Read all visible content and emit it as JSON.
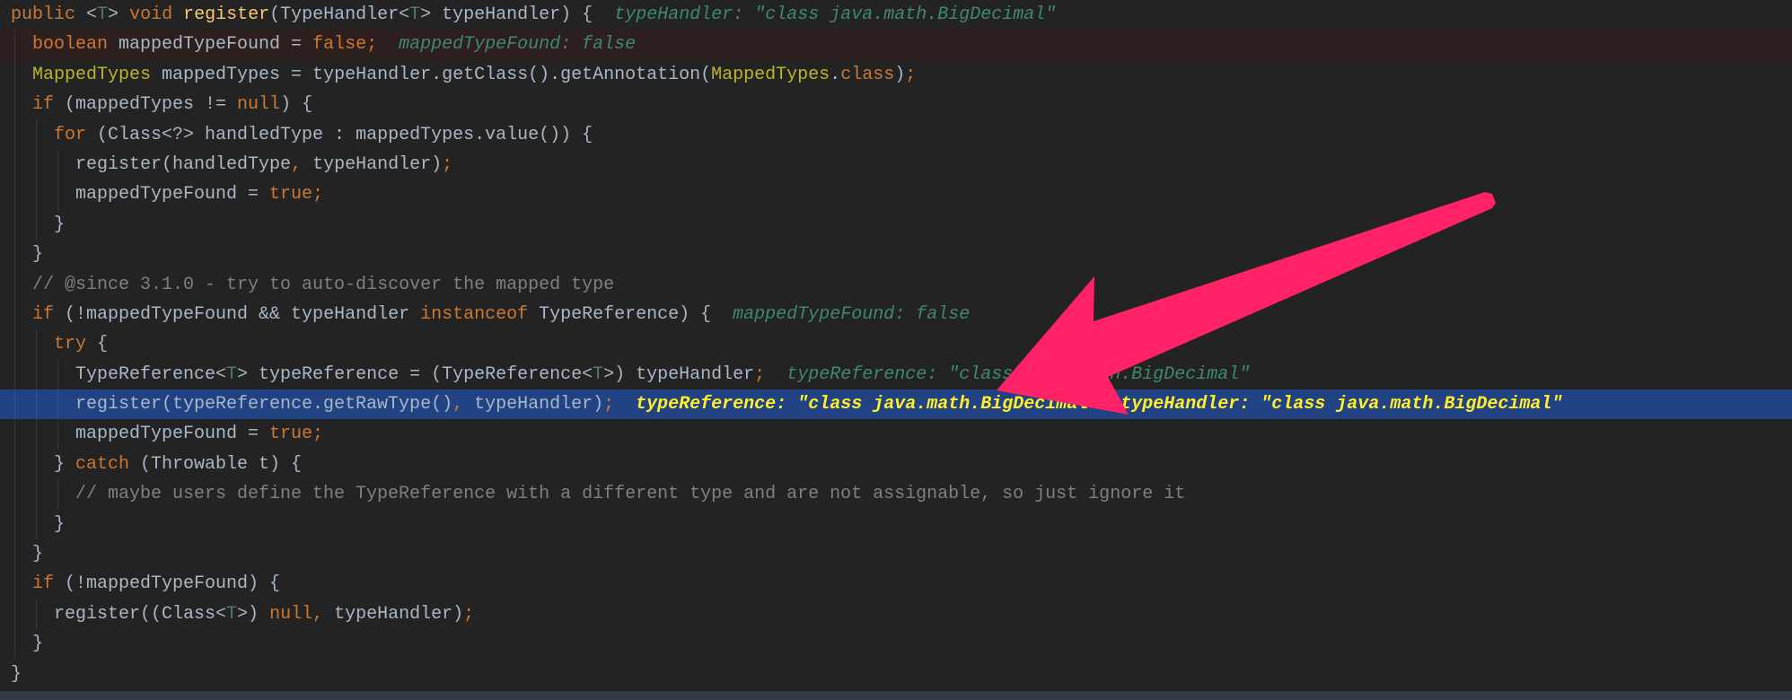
{
  "colors": {
    "background": "#232323",
    "highlight_line": "#214283",
    "breakpoint_line": "#2e1f1f",
    "keyword": "#cc7832",
    "text": "#a9b7c6",
    "method": "#ffc66d",
    "annotation": "#bbb529",
    "type_param": "#507874",
    "comment": "#808080",
    "debug_value": "#3e8a6a",
    "debug_value_current": "#ffef28",
    "annotation_arrow": "#ff2266"
  },
  "code": {
    "lines": [
      {
        "indent": 0,
        "tokens": [
          {
            "c": "kw",
            "t": "public "
          },
          {
            "c": "plain",
            "t": "<"
          },
          {
            "c": "tp",
            "t": "T"
          },
          {
            "c": "plain",
            "t": "> "
          },
          {
            "c": "kw",
            "t": "void "
          },
          {
            "c": "fn",
            "t": "register"
          },
          {
            "c": "plain",
            "t": "(TypeHandler<"
          },
          {
            "c": "tp",
            "t": "T"
          },
          {
            "c": "plain",
            "t": "> typeHandler) {  "
          },
          {
            "c": "dbg",
            "t": "typeHandler: \"class java.math.BigDecimal\""
          }
        ]
      },
      {
        "indent": 1,
        "breakpoint": true,
        "tokens": [
          {
            "c": "kw",
            "t": "boolean "
          },
          {
            "c": "plain",
            "t": "mappedTypeFound = "
          },
          {
            "c": "kw",
            "t": "false;"
          },
          {
            "c": "plain",
            "t": "  "
          },
          {
            "c": "dbg",
            "t": "mappedTypeFound: false"
          }
        ]
      },
      {
        "indent": 1,
        "tokens": [
          {
            "c": "ann",
            "t": "MappedTypes"
          },
          {
            "c": "plain",
            "t": " mappedTypes = typeHandler.getClass().getAnnotation("
          },
          {
            "c": "ann",
            "t": "MappedTypes"
          },
          {
            "c": "plain",
            "t": "."
          },
          {
            "c": "kw",
            "t": "class"
          },
          {
            "c": "plain",
            "t": ")"
          },
          {
            "c": "kw",
            "t": ";"
          }
        ]
      },
      {
        "indent": 1,
        "tokens": [
          {
            "c": "kw",
            "t": "if "
          },
          {
            "c": "plain",
            "t": "(mappedTypes != "
          },
          {
            "c": "kw",
            "t": "null"
          },
          {
            "c": "plain",
            "t": ") {"
          }
        ]
      },
      {
        "indent": 2,
        "tokens": [
          {
            "c": "kw",
            "t": "for "
          },
          {
            "c": "plain",
            "t": "(Class<?> handledType : mappedTypes.value()) {"
          }
        ]
      },
      {
        "indent": 3,
        "tokens": [
          {
            "c": "plain",
            "t": "register(handledType"
          },
          {
            "c": "kw",
            "t": ", "
          },
          {
            "c": "plain",
            "t": "typeHandler)"
          },
          {
            "c": "kw",
            "t": ";"
          }
        ]
      },
      {
        "indent": 3,
        "tokens": [
          {
            "c": "plain",
            "t": "mappedTypeFound = "
          },
          {
            "c": "kw",
            "t": "true;"
          }
        ]
      },
      {
        "indent": 2,
        "tokens": [
          {
            "c": "plain",
            "t": "}"
          }
        ]
      },
      {
        "indent": 1,
        "tokens": [
          {
            "c": "plain",
            "t": "}"
          }
        ]
      },
      {
        "indent": 1,
        "tokens": [
          {
            "c": "cm",
            "t": "// @since 3.1.0 - try to auto-discover the mapped type"
          }
        ]
      },
      {
        "indent": 1,
        "tokens": [
          {
            "c": "kw",
            "t": "if "
          },
          {
            "c": "plain",
            "t": "(!mappedTypeFound && typeHandler "
          },
          {
            "c": "kw",
            "t": "instanceof "
          },
          {
            "c": "plain",
            "t": "TypeReference) {  "
          },
          {
            "c": "dbg",
            "t": "mappedTypeFound: false"
          }
        ]
      },
      {
        "indent": 2,
        "tokens": [
          {
            "c": "kw",
            "t": "try "
          },
          {
            "c": "plain",
            "t": "{"
          }
        ]
      },
      {
        "indent": 3,
        "tokens": [
          {
            "c": "plain",
            "t": "TypeReference<"
          },
          {
            "c": "tp",
            "t": "T"
          },
          {
            "c": "plain",
            "t": "> typeReference = (TypeReference<"
          },
          {
            "c": "tp",
            "t": "T"
          },
          {
            "c": "plain",
            "t": ">) typeHandler"
          },
          {
            "c": "kw",
            "t": ";"
          },
          {
            "c": "plain",
            "t": "  "
          },
          {
            "c": "dbg",
            "t": "typeReference: \"class java.math.BigDecimal\""
          }
        ]
      },
      {
        "indent": 3,
        "current": true,
        "tokens": [
          {
            "c": "plain",
            "t": "register(typeReference.getRawType()"
          },
          {
            "c": "kw",
            "t": ", "
          },
          {
            "c": "plain",
            "t": "typeHandler)"
          },
          {
            "c": "kw",
            "t": ";"
          },
          {
            "c": "plain",
            "t": "  "
          },
          {
            "c": "dbgh",
            "t": "typeReference: \"class java.math.BigDecimal\""
          },
          {
            "c": "plain",
            "t": "  "
          },
          {
            "c": "dbgh",
            "t": "typeHandler: \"class java.math.BigDecimal\""
          }
        ]
      },
      {
        "indent": 3,
        "tokens": [
          {
            "c": "plain",
            "t": "mappedTypeFound = "
          },
          {
            "c": "kw",
            "t": "true;"
          }
        ]
      },
      {
        "indent": 2,
        "tokens": [
          {
            "c": "plain",
            "t": "} "
          },
          {
            "c": "kw",
            "t": "catch "
          },
          {
            "c": "plain",
            "t": "(Throwable t) {"
          }
        ]
      },
      {
        "indent": 3,
        "tokens": [
          {
            "c": "cm",
            "t": "// maybe users define the TypeReference with a different type and are not assignable, so just ignore it"
          }
        ]
      },
      {
        "indent": 2,
        "tokens": [
          {
            "c": "plain",
            "t": "}"
          }
        ]
      },
      {
        "indent": 1,
        "tokens": [
          {
            "c": "plain",
            "t": "}"
          }
        ]
      },
      {
        "indent": 1,
        "tokens": [
          {
            "c": "kw",
            "t": "if "
          },
          {
            "c": "plain",
            "t": "(!mappedTypeFound) {"
          }
        ]
      },
      {
        "indent": 2,
        "tokens": [
          {
            "c": "plain",
            "t": "register((Class<"
          },
          {
            "c": "tp",
            "t": "T"
          },
          {
            "c": "plain",
            "t": ">) "
          },
          {
            "c": "kw",
            "t": "null, "
          },
          {
            "c": "plain",
            "t": "typeHandler)"
          },
          {
            "c": "kw",
            "t": ";"
          }
        ]
      },
      {
        "indent": 1,
        "tokens": [
          {
            "c": "plain",
            "t": "}"
          }
        ]
      },
      {
        "indent": 0,
        "tokens": [
          {
            "c": "plain",
            "t": "}"
          }
        ]
      }
    ]
  }
}
